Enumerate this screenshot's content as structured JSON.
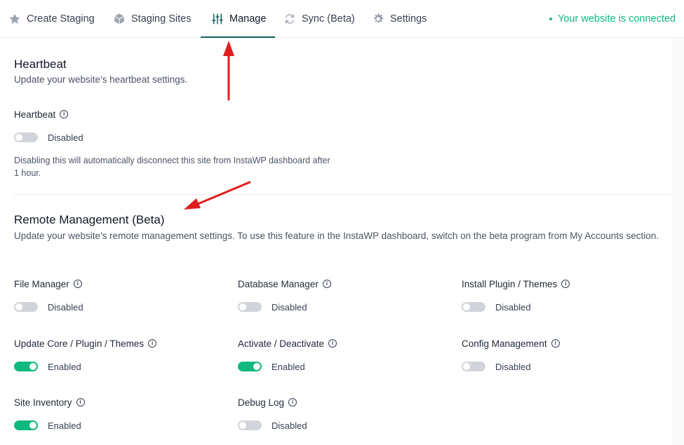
{
  "tabs": [
    {
      "label": "Create Staging",
      "icon": "star-icon"
    },
    {
      "label": "Staging Sites",
      "icon": "cube-icon"
    },
    {
      "label": "Manage",
      "icon": "sliders-icon",
      "active": true
    },
    {
      "label": "Sync (Beta)",
      "icon": "sync-icon"
    },
    {
      "label": "Settings",
      "icon": "gear-icon"
    }
  ],
  "status": {
    "text": "Your website is connected",
    "color": "#10b981"
  },
  "heartbeat": {
    "title": "Heartbeat",
    "description": "Update your website's heartbeat settings.",
    "label": "Heartbeat",
    "state": "Disabled",
    "helper": "Disabling this will automatically disconnect this site from InstaWP dashboard after 1 hour."
  },
  "remote": {
    "title": "Remote Management (Beta)",
    "description": "Update your website's remote management settings. To use this feature in the InstaWP dashboard, switch on the beta program from My Accounts section.",
    "items": [
      {
        "label": "File Manager",
        "state": "Disabled"
      },
      {
        "label": "Database Manager",
        "state": "Disabled"
      },
      {
        "label": "Install Plugin / Themes",
        "state": "Disabled"
      },
      {
        "label": "Update Core / Plugin / Themes",
        "state": "Enabled"
      },
      {
        "label": "Activate / Deactivate",
        "state": "Enabled"
      },
      {
        "label": "Config Management",
        "state": "Disabled"
      },
      {
        "label": "Site Inventory",
        "state": "Enabled"
      },
      {
        "label": "Debug Log",
        "state": "Disabled"
      }
    ]
  },
  "colors": {
    "accent": "#115e59",
    "enabled": "#10b981",
    "annotation": "#e11d1d"
  }
}
